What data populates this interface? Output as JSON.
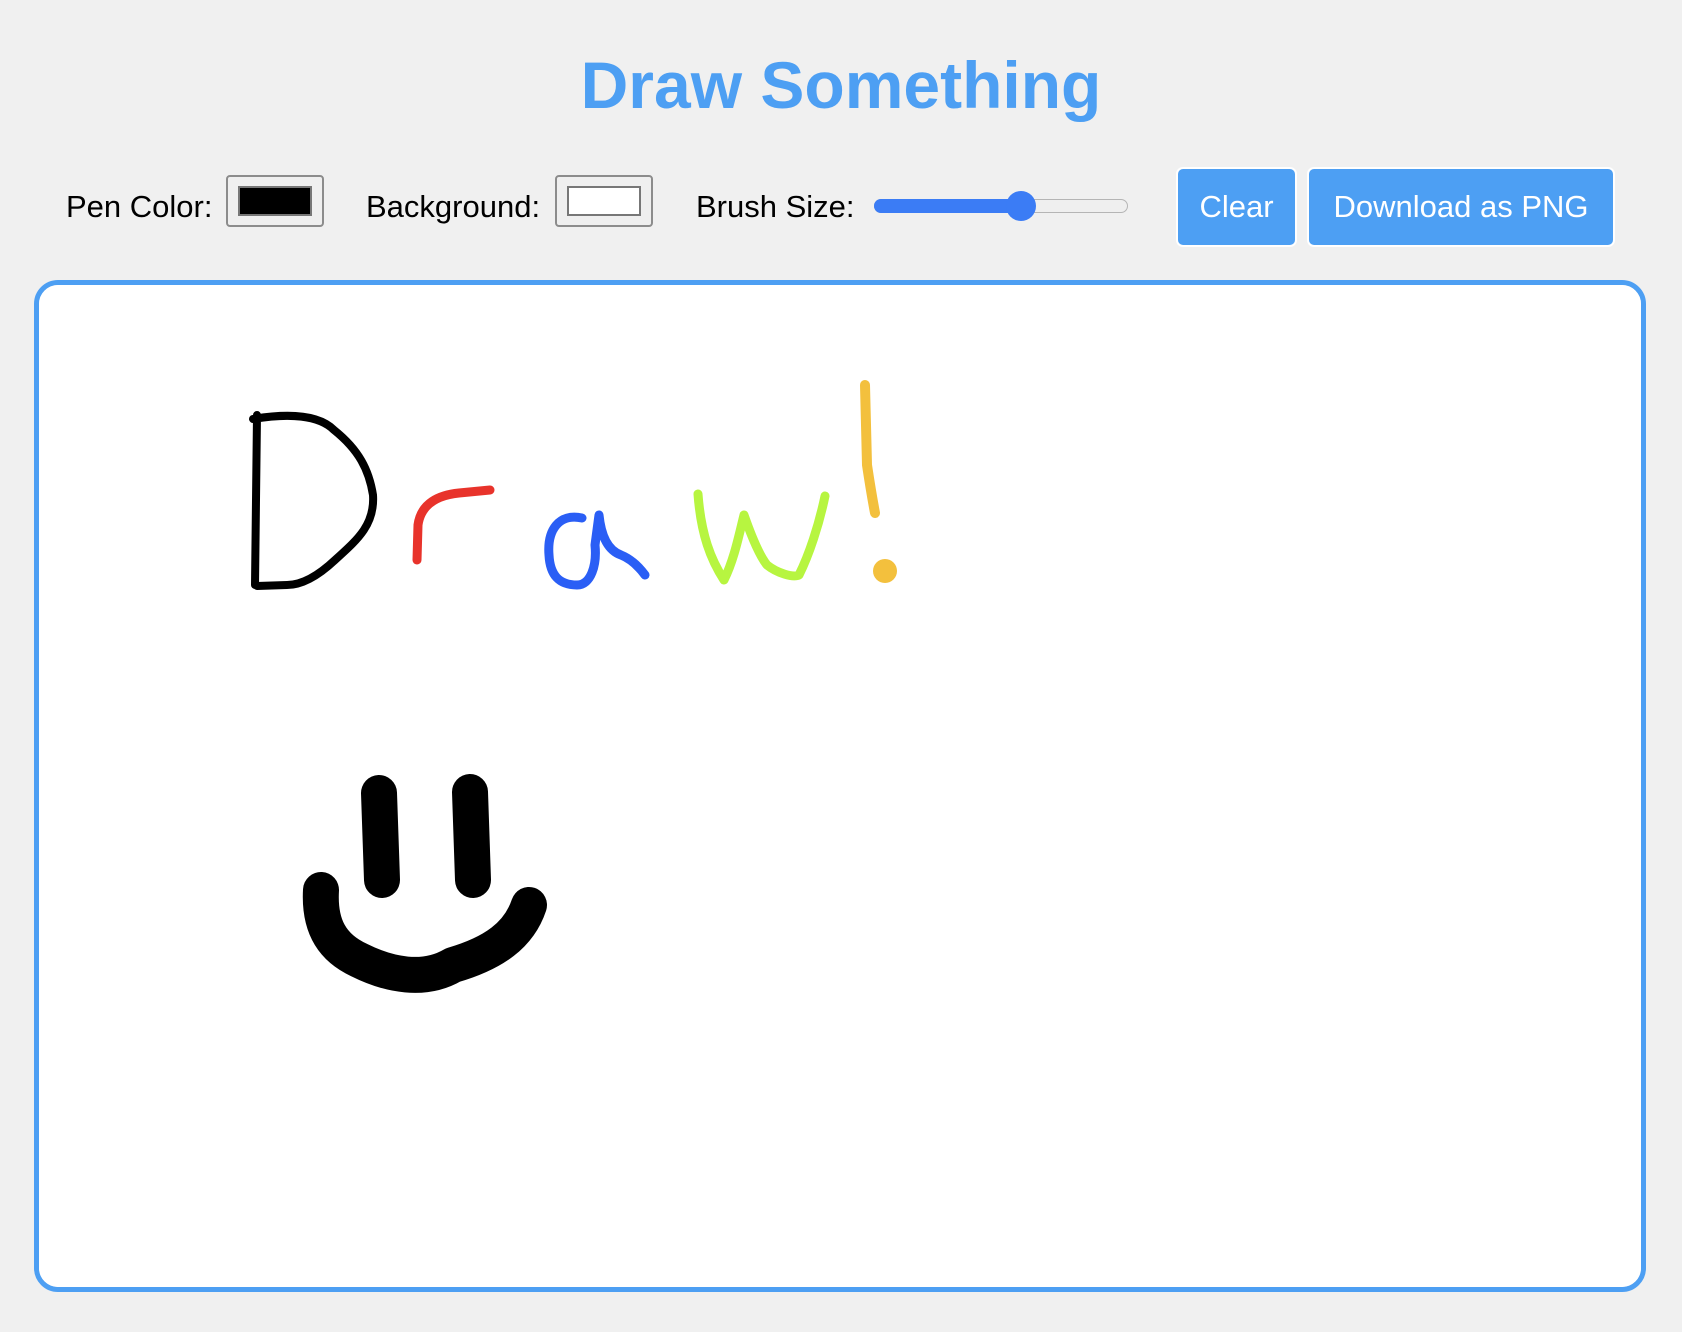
{
  "title": "Draw Something",
  "controls": {
    "pen_color_label": "Pen Color:",
    "pen_color_value": "#000000",
    "background_label": "Background:",
    "background_value": "#ffffff",
    "brush_size_label": "Brush Size:",
    "brush_size_fraction": 0.58,
    "clear_label": "Clear",
    "download_label": "Download as PNG"
  },
  "theme": {
    "accent": "#4d9ff3",
    "slider_accent": "#3b7cf5",
    "page_background": "#f0f0f0"
  },
  "drawing": {
    "stroke_colors": {
      "d": "#000000",
      "r": "#e8332b",
      "a": "#2a5ef5",
      "w": "#b7f540",
      "exclamation": "#f3c03d",
      "smiley": "#000000"
    }
  }
}
